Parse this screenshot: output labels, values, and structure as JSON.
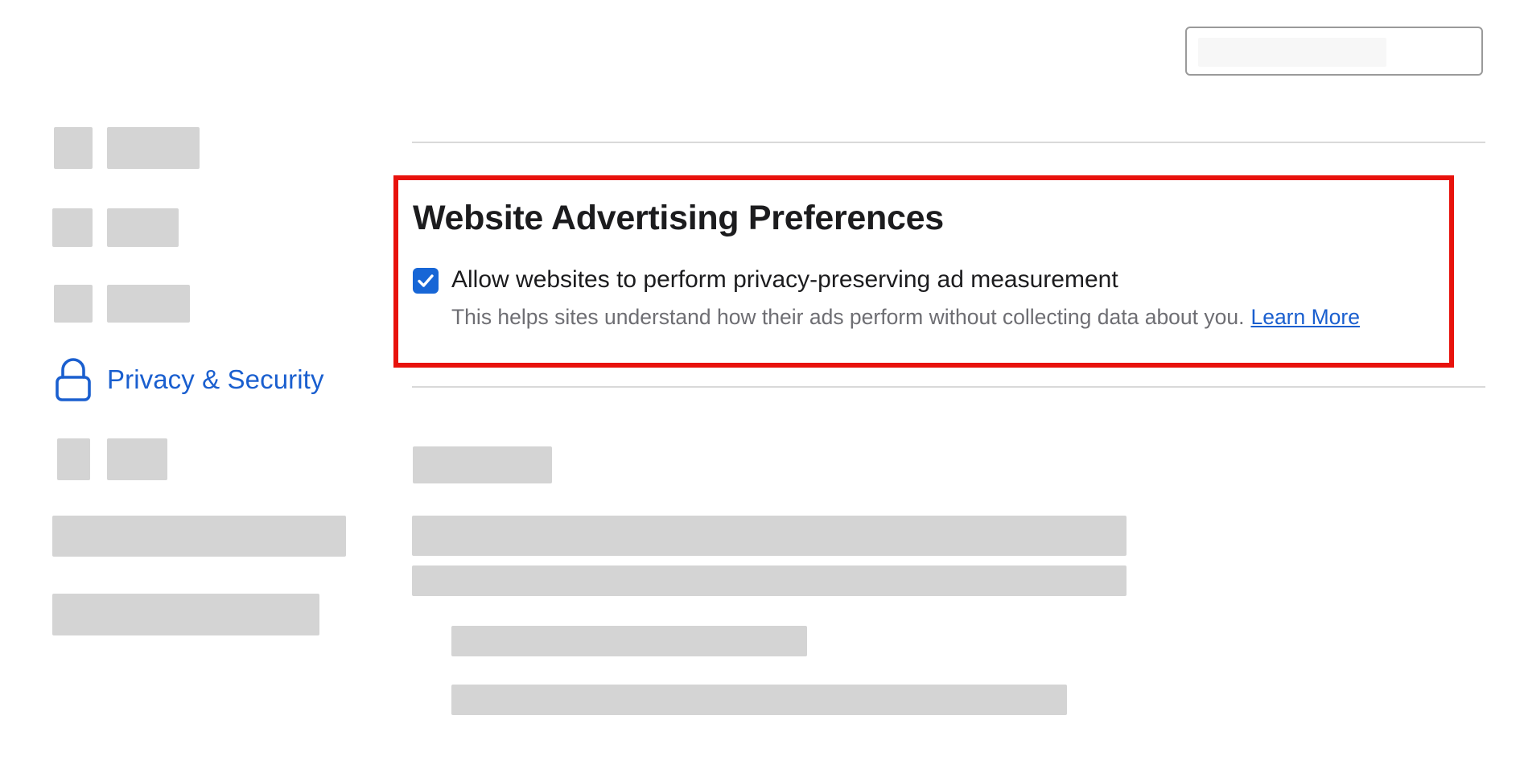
{
  "sidebar": {
    "selected_item": {
      "label": "Privacy & Security",
      "icon": "lock-icon"
    }
  },
  "main": {
    "section": {
      "title": "Website Advertising Preferences",
      "option": {
        "label": "Allow websites to perform privacy-preserving ad measurement",
        "checked": true,
        "description": "This helps sites understand how their ads perform without collecting data about you.",
        "link_label": "Learn More"
      }
    }
  },
  "colors": {
    "accent": "#1a5fcf",
    "checkbox": "#1766d6",
    "highlight": "#e8120c",
    "placeholder": "#d4d4d4"
  }
}
